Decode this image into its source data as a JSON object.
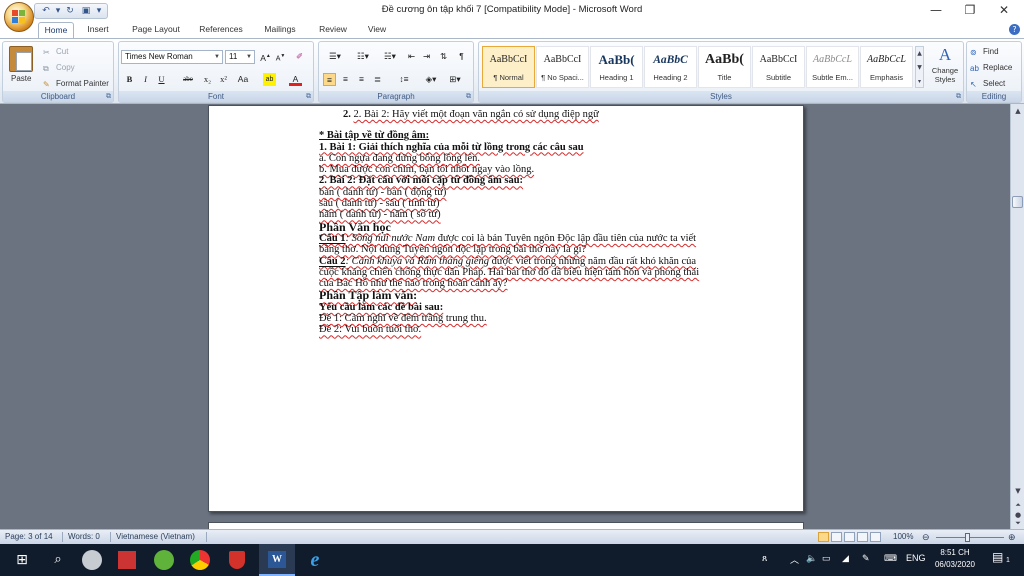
{
  "window": {
    "title": "Đề cương ôn tập khối 7 [Compatibility Mode] - Microsoft Word",
    "minimize_glyph": "—",
    "restore_glyph": "❐",
    "close_glyph": "✕"
  },
  "tabs": [
    "Home",
    "Insert",
    "Page Layout",
    "References",
    "Mailings",
    "Review",
    "View"
  ],
  "active_tab": "Home",
  "clipboard": {
    "paste_label": "Paste",
    "cut_label": "Cut",
    "copy_label": "Copy",
    "format_painter_label": "Format Painter",
    "group_label": "Clipboard"
  },
  "font": {
    "font_name": "Times New Roman",
    "font_size": "11",
    "group_label": "Font",
    "buttons": [
      "B",
      "I",
      "U",
      "abe",
      "x₂",
      "x²",
      "Aa"
    ]
  },
  "paragraph": {
    "group_label": "Paragraph"
  },
  "styles": {
    "group_label": "Styles",
    "items": [
      {
        "sample": "AaBbCcI",
        "name": "¶ Normal"
      },
      {
        "sample": "AaBbCcI",
        "name": "¶ No Spaci..."
      },
      {
        "sample": "AaBb(",
        "name": "Heading 1"
      },
      {
        "sample": "AaBbC",
        "name": "Heading 2"
      },
      {
        "sample": "AaBb(",
        "name": "Title"
      },
      {
        "sample": "AaBbCcI",
        "name": "Subtitle"
      },
      {
        "sample": "AaBbCcL",
        "name": "Subtle Em..."
      },
      {
        "sample": "AaBbCcL",
        "name": "Emphasis"
      }
    ],
    "change_styles_label": "Change Styles"
  },
  "editing": {
    "group_label": "Editing",
    "find_label": "Find",
    "replace_label": "Replace",
    "select_label": "Select"
  },
  "document": {
    "line_top": "2. Bài 2: Hãy viết một đoạn văn ngắn có sử dụng điệp ngữ",
    "section_homonym": "* Bài tập về từ đồng âm:",
    "ex1_title": "1. Bài 1: Giải thích nghĩa của mỗi từ lồng trong các câu sau",
    "ex1_a": "a. Con ngựa đang đứng bỗng lồng lên.",
    "ex1_b": "b. Mua được con chim, bạn tôi nhốt ngay vào lồng.",
    "ex2_title": "2. Bài 2: Đặt câu với mỗi cặp từ đồng âm sau:",
    "ex2_l1": "bàn ( danh từ)  - bàn ( động từ)",
    "ex2_l2": "sâu ( danh từ) - sâu ( tính từ)",
    "ex2_l3": "năm ( danh từ) - năm ( số từ)",
    "lit_heading": "Phần Văn học",
    "q1_label": "Câu 1",
    "q1_title": ": Sông núi nước Nam",
    "q1_text1": " được coi là bản Tuyên ngôn Độc lập đầu tiên của nước ta viết",
    "q1_text2": "bằng thơ. Nội dung Tuyên ngôn độc lập trong bài thơ này là gì?",
    "q2_label": "Câu 2",
    "q2_title": ": Cảnh khuya và Rằm tháng giêng",
    "q2_text1": " được viết trong những năm đầu rất khó khăn của",
    "q2_text2": "cuộc kháng chiến chống thực dân Pháp. Hai bài thơ đó đã biểu hiện tâm hồn và phong thái",
    "q2_text3": "của Bác Hồ như thế nào trong hoàn cảnh ấy?",
    "writing_heading": "Phần Tập làm văn:",
    "writing_sub": "Yêu cầu làm các đề bài sau:",
    "topic1": "Đề 1: Cảm nghĩ về đêm trăng trung thu.",
    "topic2": "Đề 2: Vui buồn tuổi thơ."
  },
  "status": {
    "page": "Page: 3 of 14",
    "words": "Words: 0",
    "language": "Vietnamese (Vietnam)",
    "zoom": "100%"
  },
  "taskbar": {
    "ime": "ENG",
    "time": "8:51 CH",
    "date": "06/03/2020",
    "notification_count": "1"
  }
}
